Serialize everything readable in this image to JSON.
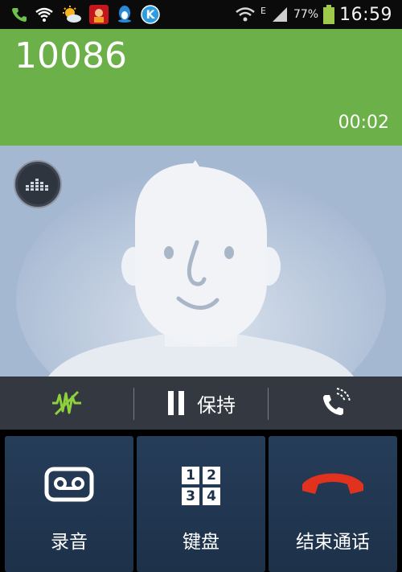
{
  "status_bar": {
    "battery_percent": "77%",
    "time": "16:59",
    "data_indicator": "E",
    "icons": [
      "phone-call-icon",
      "wifi-icon",
      "weather-sun-cloud-icon",
      "app-avatar-icon",
      "qq-penguin-icon",
      "k-app-icon",
      "wifi-signal-icon",
      "cell-signal-icon",
      "battery-icon"
    ]
  },
  "call": {
    "number": "10086",
    "duration": "00:02"
  },
  "controls": {
    "noise_reduction_icon": "noise-reduction-icon",
    "hold_label": "保持",
    "volume_icon": "call-volume-icon"
  },
  "actions": {
    "record_label": "录音",
    "keypad_label": "键盘",
    "keypad_digits": [
      "1",
      "2",
      "3",
      "4"
    ],
    "end_call_label": "结束通话"
  },
  "colors": {
    "header_green": "#6cb04a",
    "photo_blue": "#a5b8d2",
    "tile_blue": "#263d59",
    "end_call_red": "#e0321e",
    "noise_green": "#8fd13a"
  }
}
